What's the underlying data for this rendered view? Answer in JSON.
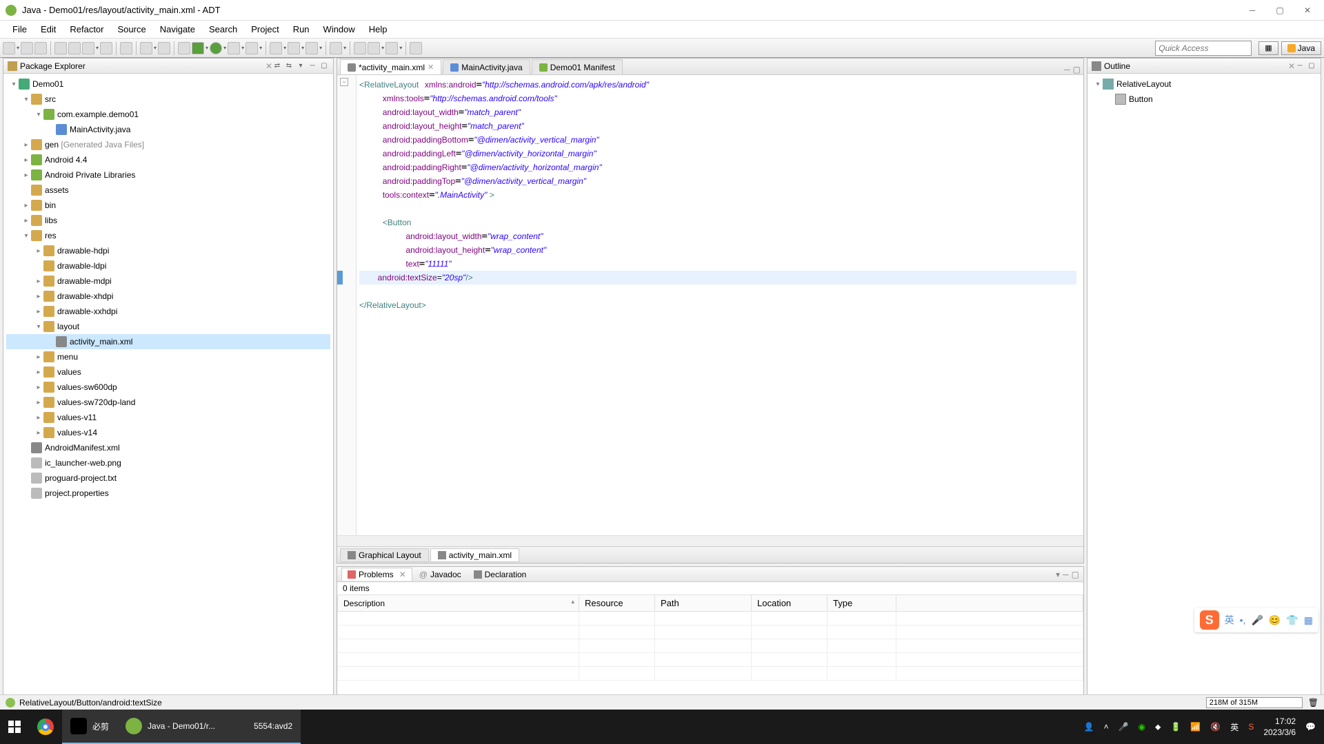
{
  "titlebar": {
    "title": "Java - Demo01/res/layout/activity_main.xml - ADT"
  },
  "menu": [
    "File",
    "Edit",
    "Refactor",
    "Source",
    "Navigate",
    "Search",
    "Project",
    "Run",
    "Window",
    "Help"
  ],
  "quick_access": "Quick Access",
  "perspective": {
    "java": "Java"
  },
  "package_explorer": {
    "title": "Package Explorer",
    "tree": {
      "project": "Demo01",
      "src": "src",
      "pkg": "com.example.demo01",
      "main_activity": "MainActivity.java",
      "gen": "gen",
      "gen_suffix": "[Generated Java Files]",
      "android44": "Android 4.4",
      "priv_libs": "Android Private Libraries",
      "assets": "assets",
      "bin": "bin",
      "libs": "libs",
      "res": "res",
      "drawable_hdpi": "drawable-hdpi",
      "drawable_ldpi": "drawable-ldpi",
      "drawable_mdpi": "drawable-mdpi",
      "drawable_xhdpi": "drawable-xhdpi",
      "drawable_xxhdpi": "drawable-xxhdpi",
      "layout": "layout",
      "activity_main_xml": "activity_main.xml",
      "menu_folder": "menu",
      "values": "values",
      "values_sw600dp": "values-sw600dp",
      "values_sw720dp_land": "values-sw720dp-land",
      "values_v11": "values-v11",
      "values_v14": "values-v14",
      "manifest": "AndroidManifest.xml",
      "ic_launcher": "ic_launcher-web.png",
      "proguard": "proguard-project.txt",
      "project_props": "project.properties"
    }
  },
  "editor": {
    "tabs": {
      "activity_main": "*activity_main.xml",
      "main_activity_java": "MainActivity.java",
      "manifest": "Demo01 Manifest"
    },
    "bottom_tabs": {
      "graphical": "Graphical Layout",
      "source": "activity_main.xml"
    },
    "code": {
      "l1_tag": "<RelativeLayout",
      "l1_attr": "xmlns:android",
      "l1_val": "\"http://schemas.android.com/apk/res/android\"",
      "l2_attr": "xmlns:tools",
      "l2_val": "\"http://schemas.android.com/tools\"",
      "l3_attr": "android:layout_width",
      "l3_val": "\"match_parent\"",
      "l4_attr": "android:layout_height",
      "l4_val": "\"match_parent\"",
      "l5_attr": "android:paddingBottom",
      "l5_val": "\"@dimen/activity_vertical_margin\"",
      "l6_attr": "android:paddingLeft",
      "l6_val": "\"@dimen/activity_horizontal_margin\"",
      "l7_attr": "android:paddingRight",
      "l7_val": "\"@dimen/activity_horizontal_margin\"",
      "l8_attr": "android:paddingTop",
      "l8_val": "\"@dimen/activity_vertical_margin\"",
      "l9_attr": "tools:context",
      "l9_val": "\".MainActivity\"",
      "l9_end": " >",
      "l11_tag": "<Button",
      "l12_attr": "android:layout_width",
      "l12_val": "\"wrap_content\"",
      "l13_attr": "android:layout_height",
      "l13_val": "\"wrap_content\"",
      "l14_attr": "text",
      "l14_val": "\"11111\"",
      "l15_attr": "android:textSize",
      "l15_val": "\"20sp\"",
      "l15_end": "/>",
      "l17_close": "</RelativeLayout>"
    }
  },
  "outline": {
    "title": "Outline",
    "root": "RelativeLayout",
    "button": "Button"
  },
  "problems": {
    "tabs": {
      "problems": "Problems",
      "javadoc": "Javadoc",
      "declaration": "Declaration"
    },
    "count": "0 items",
    "cols": {
      "desc": "Description",
      "resource": "Resource",
      "path": "Path",
      "location": "Location",
      "type": "Type"
    }
  },
  "status": {
    "path": "RelativeLayout/Button/android:textSize",
    "mem": "218M of 315M"
  },
  "taskbar": {
    "bisheng": "必剪",
    "eclipse": "Java - Demo01/r...",
    "emulator": "5554:avd2",
    "ime": "英",
    "time": "17:02",
    "date": "2023/3/6"
  },
  "sogou": {
    "lang": "英",
    "punct": "•,",
    "mic": "🎤",
    "emoji": "😊",
    "shirt": "👕",
    "grid": "▦"
  }
}
